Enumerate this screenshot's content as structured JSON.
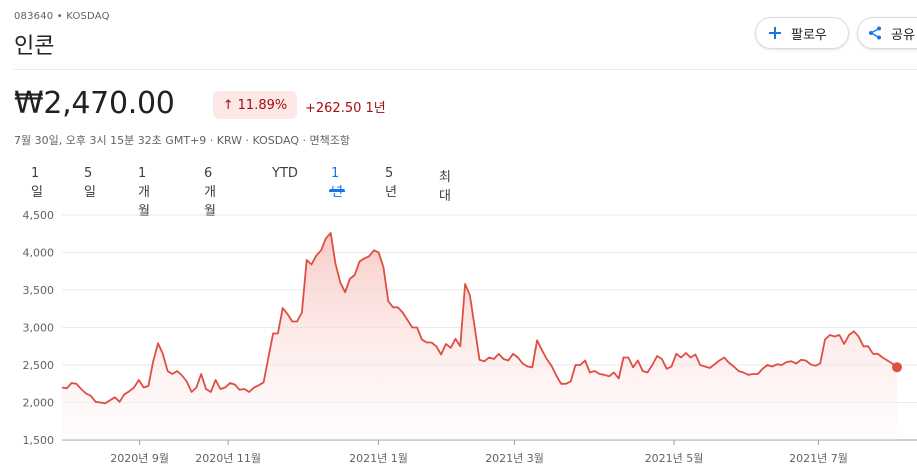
{
  "header": {
    "ticker": "083640 • KOSDAQ",
    "name": "인콘",
    "follow_label": "팔로우",
    "share_label": "공유"
  },
  "quote": {
    "price": "₩2,470.00",
    "change_percent": "11.89%",
    "change_abs": "+262.50 1년",
    "meta": "7월 30일, 오후 3시 15분 32초 GMT+9 · KRW · KOSDAQ · 면책조항"
  },
  "tabs": [
    "1일",
    "5일",
    "1개월",
    "6개월",
    "YTD",
    "1년",
    "5년",
    "최대"
  ],
  "active_tab": "1년",
  "colors": {
    "line": "#e04d43",
    "fill": "#fce8e6",
    "accent": "#1a73e8",
    "negative_badge_bg": "#fce8e6",
    "negative_text": "#a50e0e"
  },
  "icons": {
    "follow": "plus-icon",
    "share": "share-icon",
    "trend": "arrow-up-icon"
  },
  "chart_data": {
    "type": "area",
    "ylim": [
      1500,
      4500
    ],
    "yticks": [
      1500,
      2000,
      2500,
      3000,
      3500,
      4000,
      4500
    ],
    "ytick_labels": [
      "1,500",
      "2,000",
      "2,500",
      "3,000",
      "3,500",
      "4,000",
      "4,500"
    ],
    "xticks": [
      {
        "t": 0.093,
        "label": "2020년 9월"
      },
      {
        "t": 0.199,
        "label": "2020년 11월"
      },
      {
        "t": 0.379,
        "label": "2021년 1월"
      },
      {
        "t": 0.542,
        "label": "2021년 3월"
      },
      {
        "t": 0.733,
        "label": "2021년 5월"
      },
      {
        "t": 0.906,
        "label": "2021년 7월"
      }
    ],
    "series": [
      {
        "values": [
          2200,
          2190,
          2260,
          2250,
          2180,
          2120,
          2090,
          2010,
          2000,
          1990,
          2030,
          2070,
          2010,
          2110,
          2150,
          2200,
          2300,
          2200,
          2220,
          2550,
          2790,
          2650,
          2420,
          2380,
          2420,
          2360,
          2280,
          2140,
          2200,
          2380,
          2180,
          2140,
          2300,
          2180,
          2200,
          2260,
          2240,
          2170,
          2180,
          2140,
          2200,
          2230,
          2270,
          2600,
          2920,
          2920,
          3260,
          3180,
          3080,
          3080,
          3200,
          3900,
          3840,
          3960,
          4030,
          4190,
          4260,
          3850,
          3600,
          3470,
          3650,
          3700,
          3880,
          3920,
          3950,
          4030,
          4000,
          3800,
          3350,
          3270,
          3270,
          3200,
          3100,
          3000,
          3000,
          2840,
          2800,
          2800,
          2750,
          2640,
          2780,
          2730,
          2850,
          2750,
          3580,
          3430,
          3000,
          2570,
          2550,
          2600,
          2580,
          2650,
          2580,
          2560,
          2650,
          2600,
          2520,
          2480,
          2470,
          2830,
          2700,
          2580,
          2490,
          2360,
          2250,
          2250,
          2280,
          2500,
          2500,
          2560,
          2400,
          2420,
          2380,
          2370,
          2350,
          2400,
          2320,
          2600,
          2600,
          2470,
          2560,
          2420,
          2400,
          2500,
          2620,
          2580,
          2450,
          2480,
          2650,
          2600,
          2660,
          2600,
          2640,
          2500,
          2480,
          2460,
          2510,
          2560,
          2600,
          2530,
          2480,
          2420,
          2400,
          2370,
          2380,
          2380,
          2450,
          2500,
          2480,
          2510,
          2500,
          2540,
          2550,
          2520,
          2570,
          2560,
          2510,
          2490,
          2520,
          2840,
          2900,
          2880,
          2900,
          2780,
          2900,
          2950,
          2880,
          2750,
          2750,
          2650,
          2650,
          2600,
          2560,
          2520,
          2470
        ]
      }
    ]
  }
}
